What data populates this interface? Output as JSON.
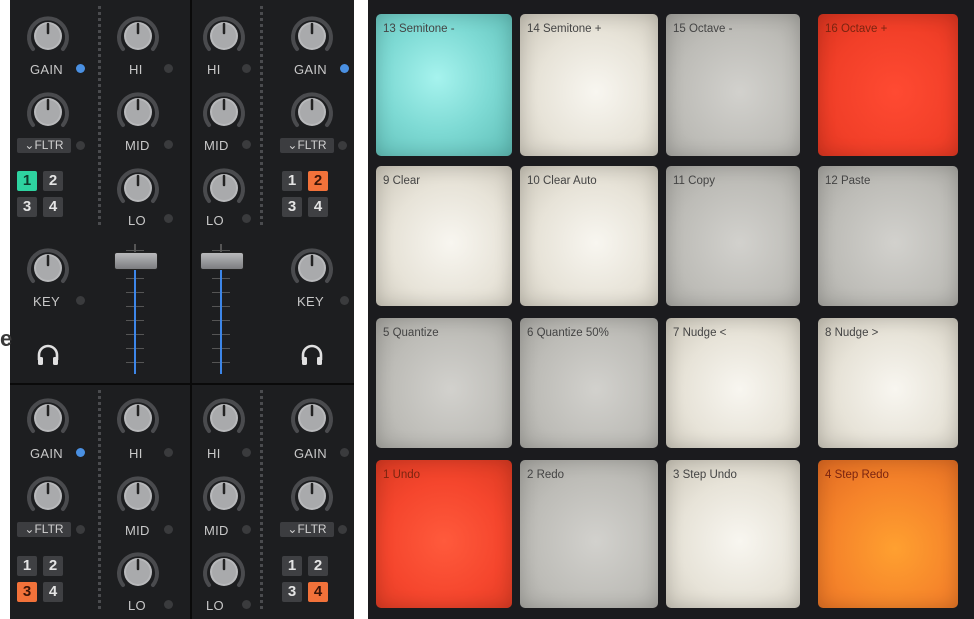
{
  "mixer": {
    "gain_label": "GAIN",
    "hi_label": "HI",
    "mid_label": "MID",
    "lo_label": "LO",
    "fltr_label": "FLTR",
    "key_label": "KEY",
    "fx_buttons": [
      "1",
      "2",
      "3",
      "4"
    ],
    "active_fx": {
      "deck_a": "1",
      "deck_b": "2",
      "deck_c": "3",
      "deck_d": "4"
    },
    "colors": {
      "accent_blue": "#4a90e2",
      "fx_teal": "#2ed3a0",
      "fx_orange": "#f2723a"
    }
  },
  "stray_text": "e",
  "pads": [
    {
      "num": "13",
      "label": "Semitone -",
      "color": "teal"
    },
    {
      "num": "14",
      "label": "Semitone +",
      "color": "white"
    },
    {
      "num": "15",
      "label": "Octave -",
      "color": "grey"
    },
    {
      "num": "16",
      "label": "Octave +",
      "color": "red"
    },
    {
      "num": "9",
      "label": "Clear",
      "color": "white"
    },
    {
      "num": "10",
      "label": "Clear Auto",
      "color": "white"
    },
    {
      "num": "11",
      "label": "Copy",
      "color": "grey"
    },
    {
      "num": "12",
      "label": "Paste",
      "color": "grey"
    },
    {
      "num": "5",
      "label": "Quantize",
      "color": "grey"
    },
    {
      "num": "6",
      "label": "Quantize 50%",
      "color": "grey"
    },
    {
      "num": "7",
      "label": "Nudge <",
      "color": "white"
    },
    {
      "num": "8",
      "label": "Nudge >",
      "color": "white"
    },
    {
      "num": "1",
      "label": "Undo",
      "color": "red"
    },
    {
      "num": "2",
      "label": "Redo",
      "color": "grey"
    },
    {
      "num": "3",
      "label": "Step Undo",
      "color": "white"
    },
    {
      "num": "4",
      "label": "Step Redo",
      "color": "orange"
    }
  ]
}
